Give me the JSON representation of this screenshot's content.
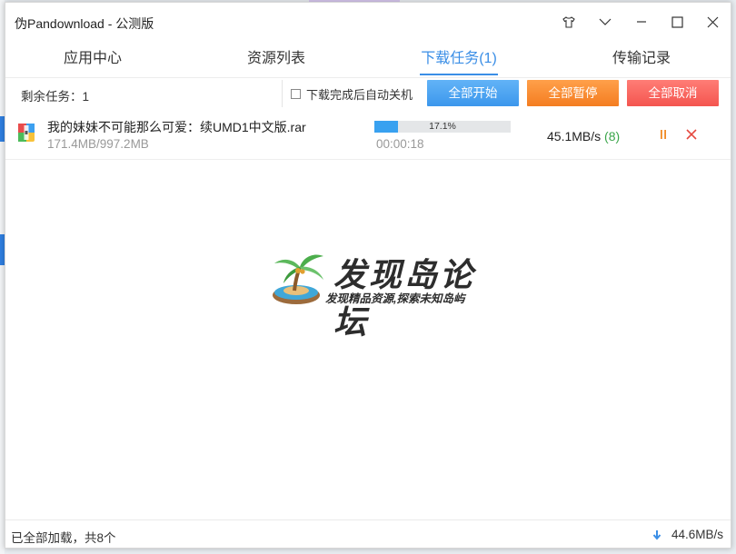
{
  "window": {
    "title": "伪Pandownload - 公测版"
  },
  "tabs": [
    {
      "label": "应用中心"
    },
    {
      "label": "资源列表"
    },
    {
      "label": "下载任务(1)"
    },
    {
      "label": "传输记录"
    }
  ],
  "toolbar": {
    "remaining": "剩余任务：1",
    "auto_shutdown_label": "下载完成后自动关机",
    "auto_shutdown_checked": false,
    "start_all": "全部开始",
    "pause_all": "全部暂停",
    "cancel_all": "全部取消"
  },
  "downloads": [
    {
      "filename": "我的妹妹不可能那么可爱：续UMD1中文版.rar",
      "size": "171.4MB/997.2MB",
      "progress_text": "17.1%",
      "progress": 0.171,
      "elapsed": "00:00:18",
      "speed": "45.1MB/s",
      "connections": "(8)"
    }
  ],
  "watermark": {
    "title": "发现岛论坛",
    "subtitle": "发现精品资源,探索未知岛屿"
  },
  "statusbar": {
    "left": "已全部加载，共8个",
    "total_speed": "44.6MB/s"
  },
  "colors": {
    "accent": "#3a8ee6",
    "start": "#3c97ec",
    "pause": "#f47d21",
    "cancel": "#f4554f",
    "progress": "#39a1f0"
  }
}
